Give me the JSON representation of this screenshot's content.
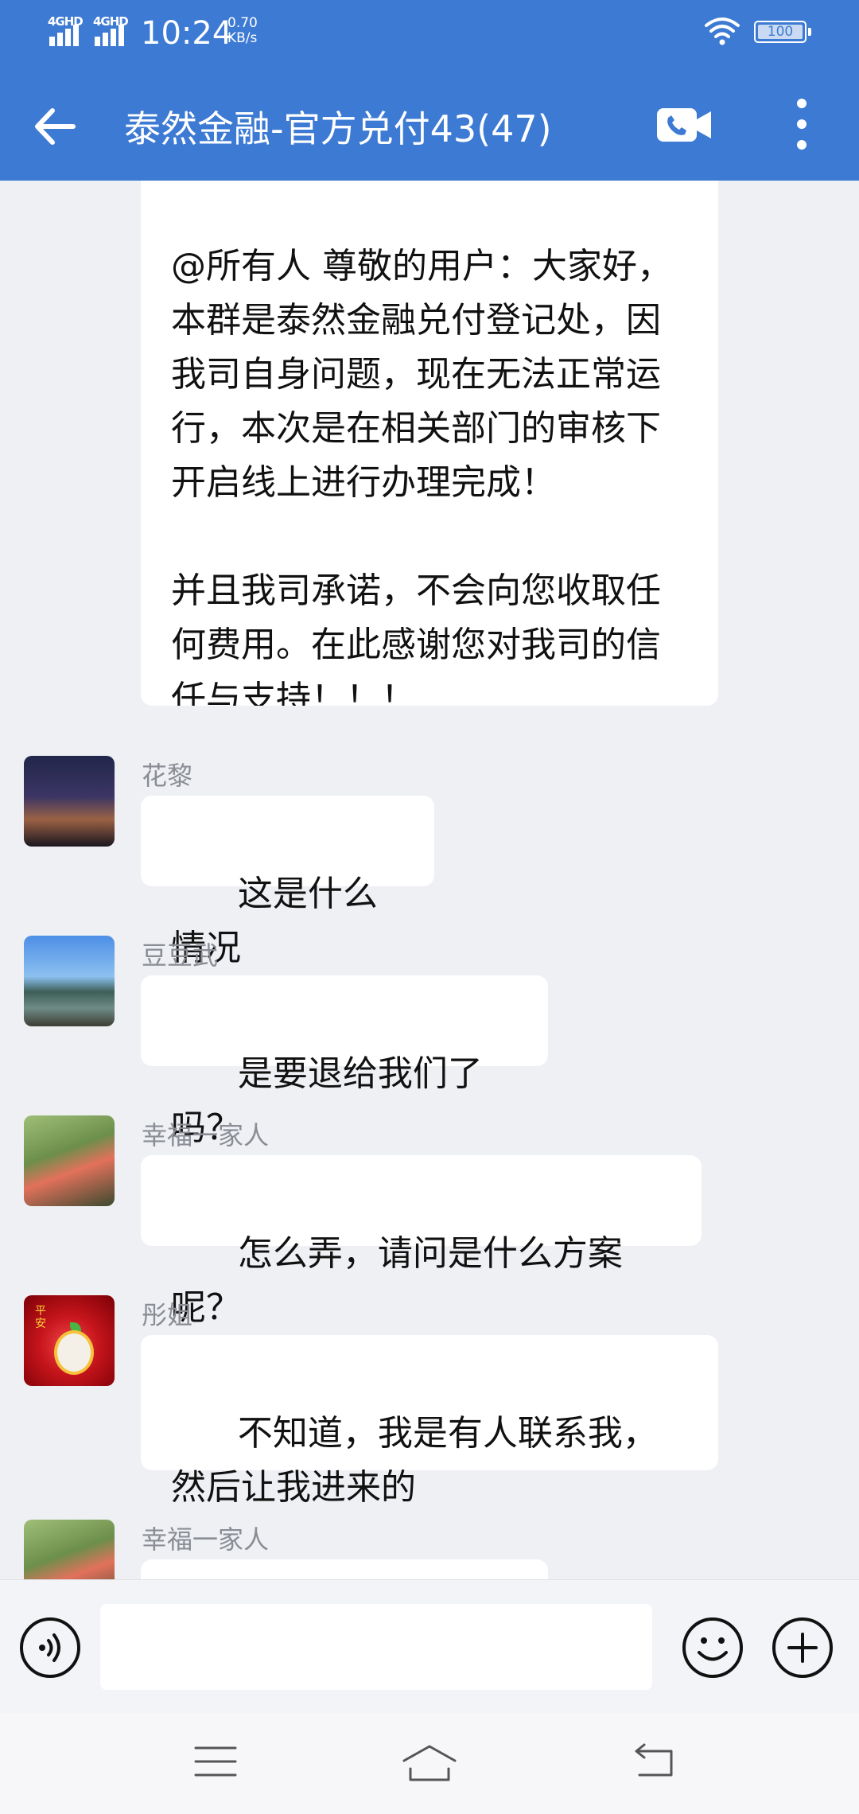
{
  "status_bar": {
    "signal_1": "4GHD",
    "signal_2": "4GHD",
    "time": "10:24",
    "speed_value": "0.70",
    "speed_unit": "KB/s",
    "battery": "100"
  },
  "title_bar": {
    "title": "泰然金融-官方兑付43(47)",
    "back_icon": "arrow-left-icon",
    "video_icon": "video-call-icon",
    "more_icon": "more-vertical-icon"
  },
  "messages": [
    {
      "sender": "",
      "avatar_icon": "pink-avatar",
      "text": "@所有人 尊敬的用户：大家好，本群是泰然金融兑付登记处，因我司自身问题，现在无法正常运行，本次是在相关部门的审核下开启线上进行办理完成！\n\n并且我司承诺，不会向您收取任何费用。在此感谢您对我司的信任与支持！！！"
    },
    {
      "sender": "花黎",
      "avatar_icon": "night-city-avatar",
      "text": "这是什么情况"
    },
    {
      "sender": "豆豆武",
      "avatar_icon": "lake-avatar",
      "text": "是要退给我们了吗？"
    },
    {
      "sender": "幸福一家人",
      "avatar_icon": "family-avatar",
      "text": "怎么弄，请问是什么方案呢？"
    },
    {
      "sender": "彤姐",
      "avatar_icon": "red-apple-avatar",
      "avatar_text": "平安",
      "text": "不知道，我是有人联系我，然后让我进来的"
    },
    {
      "sender": "幸福一家人",
      "avatar_icon": "family-avatar",
      "text": ""
    }
  ],
  "input_bar": {
    "voice_icon": "voice-icon",
    "input_value": "",
    "emoji_icon": "emoji-icon",
    "plus_icon": "plus-icon"
  },
  "nav_bar": {
    "menu_icon": "menu-icon",
    "home_icon": "home-icon",
    "back_icon": "back-icon"
  },
  "colors": {
    "header": "#3d7ad3",
    "background": "#eef0f4",
    "bubble": "#ffffff",
    "sender": "#8a8d94"
  }
}
